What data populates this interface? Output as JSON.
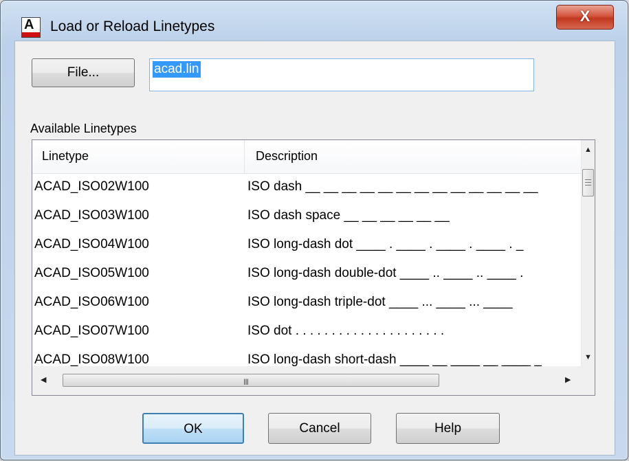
{
  "window": {
    "title": "Load or Reload Linetypes",
    "app_icon_letter": "A",
    "close_glyph": "X"
  },
  "file": {
    "button_label": "File...",
    "value": "acad.lin"
  },
  "list": {
    "section_label": "Available Linetypes",
    "columns": [
      "Linetype",
      "Description"
    ],
    "rows": [
      {
        "name": "ACAD_ISO02W100",
        "desc": "ISO dash __ __ __ __ __ __ __ __ __ __ __ __ __"
      },
      {
        "name": "ACAD_ISO03W100",
        "desc": "ISO dash space __    __    __    __    __    __"
      },
      {
        "name": "ACAD_ISO04W100",
        "desc": "ISO long-dash dot ____ . ____ . ____ . ____ . _"
      },
      {
        "name": "ACAD_ISO05W100",
        "desc": "ISO long-dash double-dot ____ .. ____ .. ____ ."
      },
      {
        "name": "ACAD_ISO06W100",
        "desc": "ISO long-dash triple-dot ____ ... ____ ... ____"
      },
      {
        "name": "ACAD_ISO07W100",
        "desc": "ISO dot . . . . . . . . . . . . . . . . . . . . ."
      },
      {
        "name": "ACAD_ISO08W100",
        "desc": "ISO long-dash short-dash ____ __ ____ __ ____ _"
      }
    ],
    "hscroll_grip": "III"
  },
  "buttons": {
    "ok": "OK",
    "cancel": "Cancel",
    "help": "Help"
  },
  "colors": {
    "selection": "#3399ff",
    "close_red": "#c0381f",
    "default_button_border": "#3c7fb1"
  }
}
